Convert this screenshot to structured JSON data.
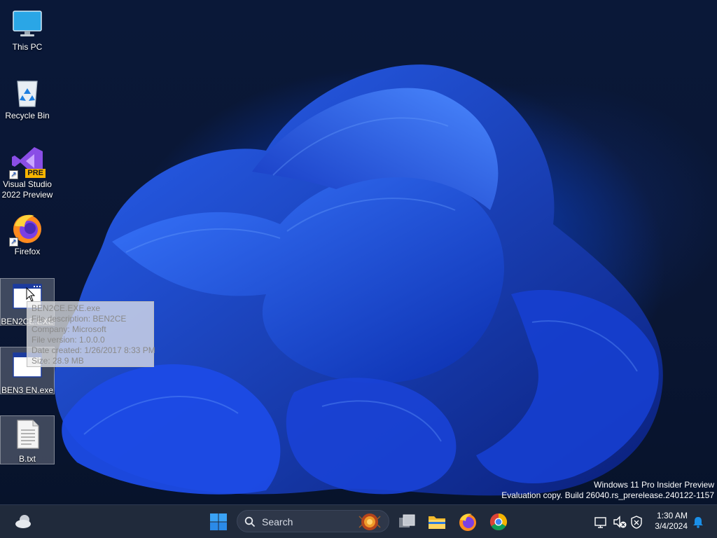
{
  "desktop": {
    "icons": [
      {
        "label": "This PC",
        "icon": "monitor-icon"
      },
      {
        "label": "Recycle Bin",
        "icon": "recycle-bin-icon"
      },
      {
        "label": "Visual Studio 2022 Preview",
        "line1": "Visual Studio",
        "line2": "2022 Preview",
        "badge": "PRE",
        "icon": "visual-studio-icon"
      },
      {
        "label": "Firefox",
        "icon": "firefox-icon"
      },
      {
        "label": "BEN2CE.EXE",
        "icon": "application-window-icon"
      },
      {
        "label": "BEN3 EN.exe",
        "icon": "application-window-icon"
      },
      {
        "label": "B.txt",
        "icon": "text-file-icon"
      }
    ]
  },
  "tooltip": {
    "name": "BEN2CE.EXE.exe",
    "description": "File description: BEN2CE",
    "company": "Company: Microsoft",
    "version": "File version: 1.0.0.0",
    "created": "Date created: 1/26/2017 8:33 PM",
    "size": "Size: 28.9 MB"
  },
  "watermark": {
    "line1": "Windows 11 Pro Insider Preview",
    "line2": "Evaluation copy. Build 26040.rs_prerelease.240122-1157"
  },
  "taskbar": {
    "search_placeholder": "Search",
    "pinned": [
      "task-view-icon",
      "file-explorer-icon",
      "firefox-icon",
      "chrome-icon"
    ],
    "time": "1:30 AM",
    "date": "3/4/2024"
  },
  "colors": {
    "wallpaper_bg": "#0a1633",
    "bloom_blue": "#1d4fe0",
    "taskbar_bg": "#202a3b",
    "accent": "#1a8fe8"
  }
}
